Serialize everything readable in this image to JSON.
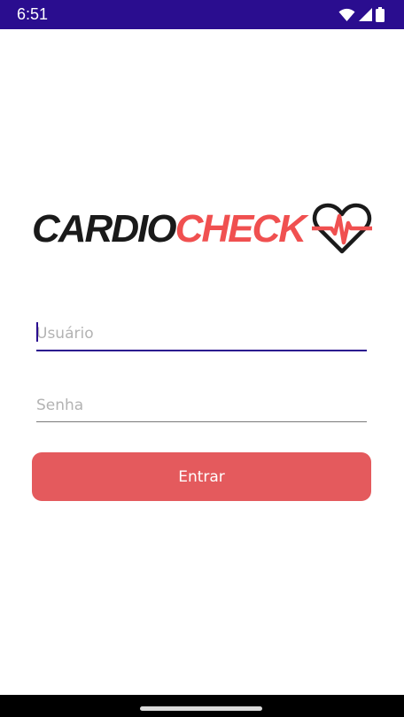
{
  "status_bar": {
    "time": "6:51",
    "icons": [
      "wifi-icon",
      "signal-icon",
      "battery-icon"
    ],
    "background": "#2a0d8f"
  },
  "logo": {
    "text_part1": "CARDIO",
    "text_part2": "CHECK",
    "color_part1": "#1a1a1a",
    "color_part2": "#f05050"
  },
  "login": {
    "username_placeholder": "Usuário",
    "username_value": "",
    "password_placeholder": "Senha",
    "password_value": "",
    "submit_label": "Entrar",
    "accent": "#2a0d8f",
    "button_color": "#e45a5d"
  }
}
